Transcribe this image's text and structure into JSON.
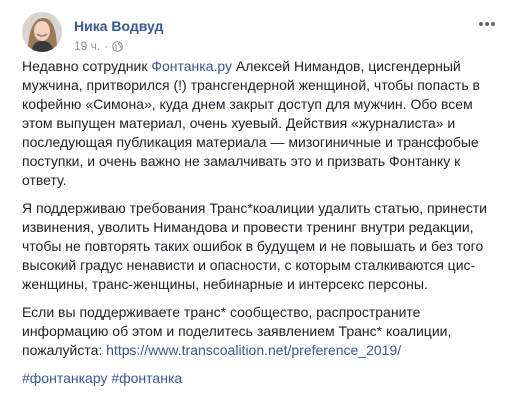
{
  "post": {
    "author": "Ника Водвуд",
    "time": "19 ч.",
    "separator": "·",
    "privacy_icon": "globe-icon",
    "more_icon": "more-options-icon",
    "paragraphs": [
      {
        "before": "Недавно сотрудник ",
        "link": "Фонтанка.ру",
        "after": " Алексей Нимандов, цисгендерный мужчина, притворился (!) трансгендерной женщиной, чтобы попасть в кофейню «Симона», куда днем закрыт доступ для мужчин. Обо всем этом выпущен материал, очень хуевый. Действия «журналиста» и последующая публикация материала — мизогиничные и трансфобые поступки, и очень важно не замалчивать это и призвать Фонтанку к ответу."
      },
      {
        "text": "Я поддерживаю требования Транс*коалиции удалить статью, принести извинения, уволить Нимандова и провести тренинг внутри редакции, чтобы не повторять таких ошибок в будущем и не повышать и без того высокий градус ненависти и опасности, с которым сталкиваются цис-женщины, транс-женщины, небинарные и интерсекс персоны."
      },
      {
        "before": "Если вы поддерживаете транс* сообщество, распространите информацию об этом и поделитесь заявлением Транс* коалиции, пожалуйста: ",
        "link": "https://www.transcoalition.net/preference_2019/"
      }
    ],
    "hashtags": [
      "#фонтанкару",
      "#фонтанка"
    ]
  },
  "colors": {
    "link": "#365899",
    "text": "#1d2129",
    "meta": "#90949c"
  }
}
